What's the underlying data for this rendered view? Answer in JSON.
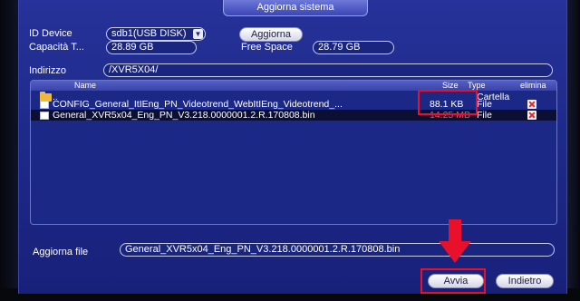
{
  "window": {
    "title": "Aggiorna sistema"
  },
  "device": {
    "id_label": "ID Device",
    "id_value": "sdb1(USB DISK)",
    "refresh_button": "Aggiorna",
    "capacity_label": "Capacità T...",
    "capacity_value": "28.89 GB",
    "free_label": "Free Space",
    "free_value": "28.79 GB"
  },
  "address": {
    "label": "Indirizzo",
    "value": "/XVR5X04/"
  },
  "file_list": {
    "columns": {
      "name": "Name",
      "size": "Size",
      "type": "Type",
      "delete": "elimina"
    },
    "rows": [
      {
        "name": "..",
        "size": "",
        "type": "Cartella",
        "icon": "folder-icon",
        "deletable": false
      },
      {
        "name": "CONFIG_General_ItIEng_PN_Videotrend_WebItIEng_Videotrend_...",
        "size": "88.1 KB",
        "type": "File",
        "icon": "file-icon",
        "deletable": true
      },
      {
        "name": "General_XVR5x04_Eng_PN_V3.218.0000001.2.R.170808.bin",
        "size": "14.25 MB",
        "type": "File",
        "icon": "file-icon",
        "deletable": true
      }
    ]
  },
  "update_file": {
    "label": "Aggiorna file",
    "value": "General_XVR5x04_Eng_PN_V3.218.0000001.2.R.170808.bin"
  },
  "actions": {
    "start_button": "Avvia",
    "back_button": "Indietro"
  },
  "colors": {
    "annotation": "#e8102a",
    "panel": "#1e2a8a"
  }
}
